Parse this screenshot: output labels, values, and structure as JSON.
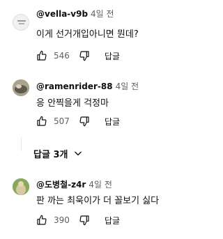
{
  "comments": [
    {
      "handle": "@vella-v9b",
      "time": "4일 전",
      "text": "이게 선거개입아니면 뭔데?",
      "likes": "546",
      "reply_label": "답글"
    },
    {
      "handle": "@ramenrider-88",
      "time": "4일 전",
      "text": "응 안찍을게 걱정마",
      "likes": "507",
      "reply_label": "답글"
    },
    {
      "handle": "@도병철-z4r",
      "time": "4일 전",
      "text": "판 까는 최욱이가 더 꼴보기 싫다",
      "likes": "390",
      "reply_label": "답글"
    }
  ],
  "replies_toggle": {
    "label": "답글 3개"
  },
  "colors": {
    "text_primary": "#0f0f0f",
    "text_secondary": "#606060"
  },
  "icons": [
    "thumb-up-icon",
    "thumb-down-icon",
    "chevron-down-icon"
  ]
}
